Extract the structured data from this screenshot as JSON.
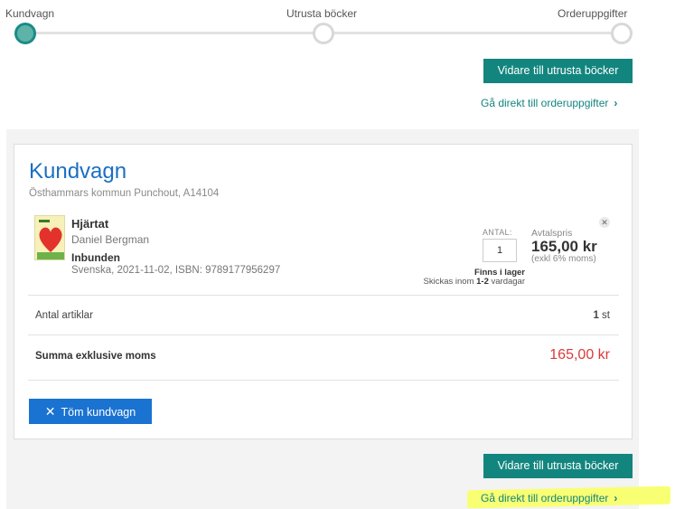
{
  "stepper": {
    "steps": [
      {
        "label": "Kundvagn",
        "active": true
      },
      {
        "label": "Utrusta böcker",
        "active": false
      },
      {
        "label": "Orderuppgifter",
        "active": false
      }
    ]
  },
  "top_actions": {
    "continue_label": "Vidare till utrusta böcker",
    "direct_link_label": "Gå direkt till orderuppgifter"
  },
  "cart": {
    "title": "Kundvagn",
    "subtitle": "Östhammars kommun Punchout, A14104",
    "item": {
      "title": "Hjärtat",
      "author": "Daniel Bergman",
      "format": "Inbunden",
      "meta": "Svenska, 2021-11-02, ISBN: 9789177956297",
      "qty_label": "ANTAL:",
      "qty_value": "1",
      "price_label": "Avtalspris",
      "price": "165,00 kr",
      "vat_note": "(exkl 6% moms)",
      "stock_status": "Finns i lager",
      "ship_prefix": "Skickas inom ",
      "ship_days": "1-2",
      "ship_suffix": " vardagar",
      "remove_icon": "close-icon"
    },
    "count_label": "Antal artiklar",
    "count_number": "1",
    "count_unit": " st",
    "total_label": "Summa exklusive moms",
    "total_value": "165,00 kr",
    "empty_label": "Töm kundvagn"
  },
  "bottom_actions": {
    "continue_label": "Vidare till utrusta böcker",
    "direct_link_label": "Gå direkt till orderuppgifter"
  },
  "colors": {
    "teal": "#13857f",
    "blue": "#1a73d1",
    "price_red": "#d93a3a",
    "highlight": "#f9ff6b"
  }
}
